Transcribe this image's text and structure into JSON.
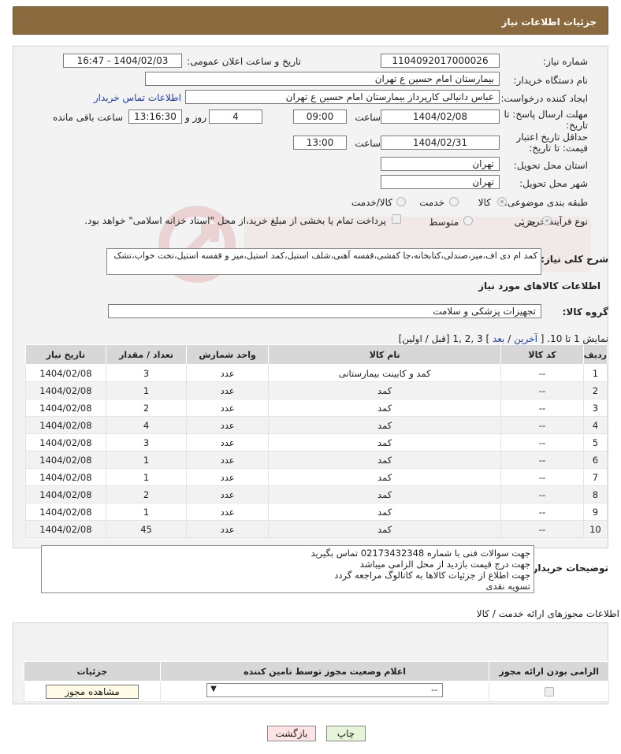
{
  "header": {
    "title": "جزئیات اطلاعات نیاز"
  },
  "form": {
    "need_number_label": "شماره نیاز:",
    "need_number": "1104092017000026",
    "announce_label": "تاریخ و ساعت اعلان عمومی:",
    "announce_value": "1404/02/03 - 16:47",
    "buyer_org_label": "نام دستگاه خریدار:",
    "buyer_org": "بیمارستان امام حسین  ع  تهران",
    "creator_label": "ایجاد کننده درخواست:",
    "creator": "عباس دانیالی کارپرداز بیمارستان امام حسین  ع  تهران",
    "buyer_contact_link": "اطلاعات تماس خریدار",
    "reply_deadline_label": "مهلت ارسال پاسخ: تا تاریخ:",
    "reply_date": "1404/02/08",
    "time_label": "ساعت",
    "reply_time": "09:00",
    "days_value": "4",
    "days_label": "روز و",
    "remaining_time": "13:16:30",
    "remaining_label": "ساعت باقی مانده",
    "validity_label": "حداقل تاریخ اعتبار قیمت: تا تاریخ:",
    "validity_date": "1404/02/31",
    "validity_time_label": "ساعت",
    "validity_time": "13:00",
    "province_label": "استان محل تحویل:",
    "province": "تهران",
    "city_label": "شهر محل تحویل:",
    "city": "تهران",
    "category_label": "طبقه بندی موضوعی:",
    "category_options": [
      "کالا",
      "خدمت",
      "کالا/خدمت"
    ],
    "process_label": "نوع فرآیند خرید :",
    "process_options": [
      "جزیی",
      "متوسط"
    ],
    "payment_note": "پرداخت تمام یا بخشی از مبلغ خرید،از محل \"اسناد خزانه اسلامی\" خواهد بود."
  },
  "summary": {
    "label": "شرح کلی نیاز:",
    "text": "کمد ام دی اف،میز،صندلی،کتابخانه،جا کفشی،قفسه آهنی،شلف استیل،کمد استیل،میز و قفسه استیل،تخت خواب،تشک"
  },
  "goods": {
    "section_title": "اطلاعات کالاهای مورد نیاز",
    "group_label": "گروه کالا:",
    "group_value": "تجهیزات پزشکی و سلامت"
  },
  "pagination": {
    "text": "نمایش 1 تا 10. [",
    "last": "آخرین",
    "sep1": " / ",
    "next": "بعد",
    "pages": "] 3 ,2 ,1",
    "after": "[قبل / اولین]"
  },
  "table": {
    "headers": [
      "ردیف",
      "کد کالا",
      "نام کالا",
      "واحد شمارش",
      "تعداد / مقدار",
      "تاریخ نیاز"
    ],
    "rows": [
      [
        "1",
        "--",
        "کمد و کابینت بیمارستانی",
        "عدد",
        "3",
        "1404/02/08"
      ],
      [
        "2",
        "--",
        "کمد",
        "عدد",
        "1",
        "1404/02/08"
      ],
      [
        "3",
        "--",
        "کمد",
        "عدد",
        "2",
        "1404/02/08"
      ],
      [
        "4",
        "--",
        "کمد",
        "عدد",
        "4",
        "1404/02/08"
      ],
      [
        "5",
        "--",
        "کمد",
        "عدد",
        "3",
        "1404/02/08"
      ],
      [
        "6",
        "--",
        "کمد",
        "عدد",
        "1",
        "1404/02/08"
      ],
      [
        "7",
        "--",
        "کمد",
        "عدد",
        "1",
        "1404/02/08"
      ],
      [
        "8",
        "--",
        "کمد",
        "عدد",
        "2",
        "1404/02/08"
      ],
      [
        "9",
        "--",
        "کمد",
        "عدد",
        "1",
        "1404/02/08"
      ],
      [
        "10",
        "--",
        "کمد",
        "عدد",
        "45",
        "1404/02/08"
      ]
    ]
  },
  "buyer_notes": {
    "label": "توضیحات خریدار:",
    "text": "جهت سوالات فنی با شماره 02173432348 تماس بگیرید\nجهت درج قیمت بازدید از محل الزامی میباشد\nجهت اطلاع از جزئیات کالاها به کاتالوگ مراجعه گردد\nتسویه نقدی"
  },
  "permits": {
    "title": "اطلاعات مجوزهای ارائه خدمت / کالا",
    "headers": [
      "الزامی بودن ارائه مجوز",
      "اعلام وضعیت مجوز توسط تامین کننده",
      "جزئیات"
    ],
    "select_value": "--",
    "view_button": "مشاهده مجوز"
  },
  "actions": {
    "print": "چاپ",
    "back": "بازگشت"
  },
  "colors": {
    "header_bg": "#8c6a3f",
    "link": "#1a3fb0"
  }
}
